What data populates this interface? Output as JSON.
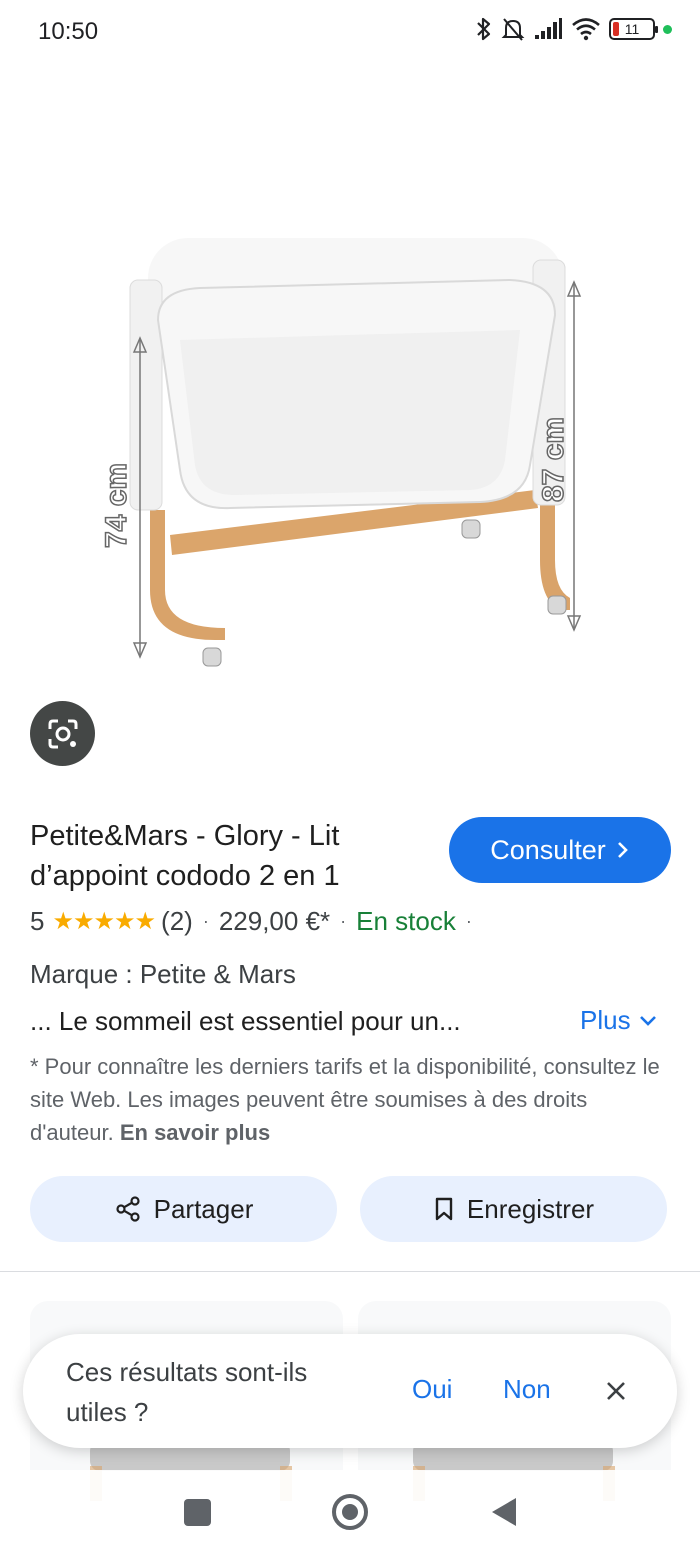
{
  "status_bar": {
    "time": "10:50",
    "battery_level": "11",
    "icons": [
      "bluetooth-icon",
      "silent-bell-icon",
      "signal-icon",
      "wifi-icon",
      "battery-icon",
      "privacy-dot-icon"
    ]
  },
  "product_image": {
    "dimension_left": "74 cm",
    "dimension_right": "87 cm"
  },
  "product": {
    "title": "Petite&Mars - Glory - Lit d’appoint cododo 2 en 1",
    "consult_label": "Consulter",
    "rating_value": "5",
    "stars": "★★★★★",
    "review_count": "(2)",
    "price": "229,00 €*",
    "stock": "En stock",
    "brand": "Marque : Petite & Mars",
    "description": "... Le sommeil est essentiel pour un...",
    "more_label": "Plus",
    "disclaimer": "* Pour connaître les derniers tarifs et la disponibilité, consultez le site Web. Les images peuvent être soumises à des droits d'auteur.",
    "learn_more": "En savoir plus"
  },
  "actions": {
    "share_label": "Partager",
    "save_label": "Enregistrer"
  },
  "feedback": {
    "question": "Ces résultats sont-ils utiles ?",
    "yes_label": "Oui",
    "no_label": "Non"
  },
  "colors": {
    "accent": "#1a73e8",
    "stock_green": "#188038",
    "star_gold": "#f9ab00",
    "chip_bg": "#e8f0fe"
  }
}
